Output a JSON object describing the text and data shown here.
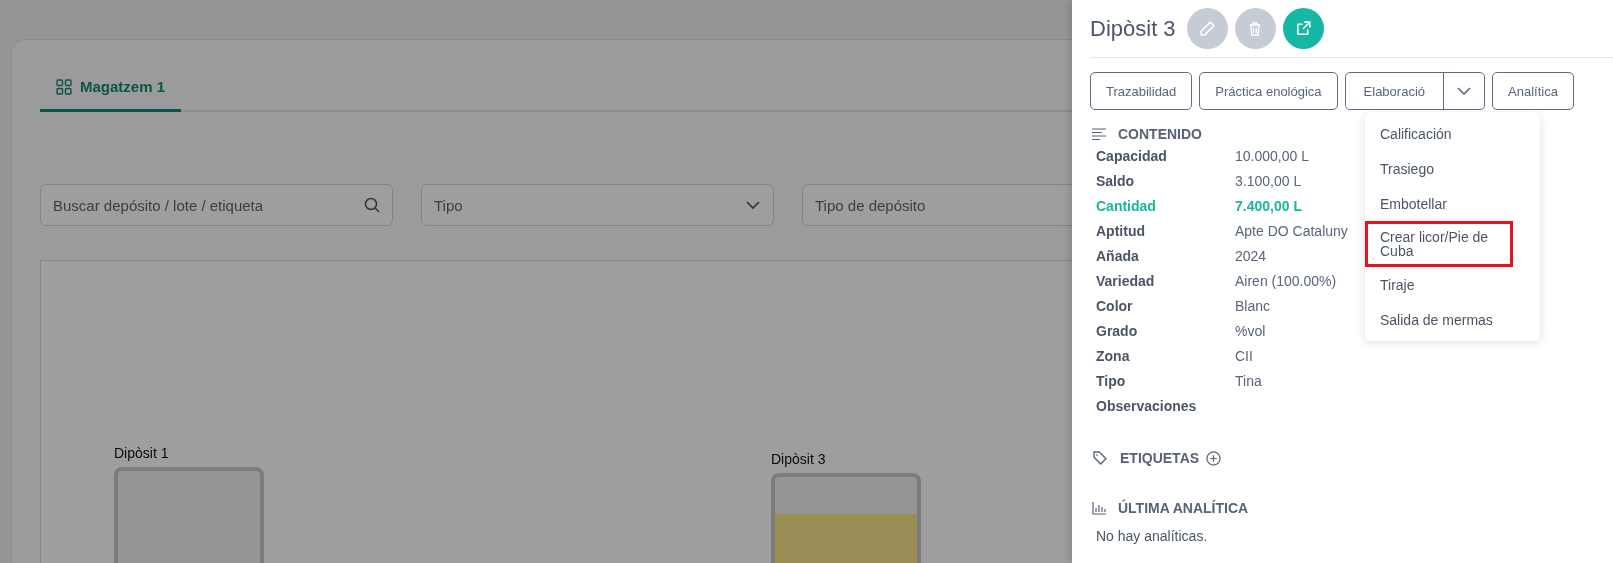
{
  "tabs": [
    {
      "label": "Magatzem 1",
      "selected": true
    }
  ],
  "filters": [
    {
      "kind": "search",
      "placeholder": "Buscar depósito / lote / etiqueta"
    },
    {
      "kind": "select",
      "placeholder": "Tipo"
    },
    {
      "kind": "select-cut",
      "placeholder": "Tipo de depósito"
    }
  ],
  "tanks": [
    {
      "name": "Dipòsit 1",
      "filled": false
    },
    {
      "name": "Dipòsit 3",
      "filled": true
    }
  ],
  "panel": {
    "title": "Dipòsit 3",
    "icon_buttons": [
      {
        "kind": "edit",
        "disabled": true
      },
      {
        "kind": "delete",
        "disabled": true
      },
      {
        "kind": "open",
        "disabled": false
      }
    ],
    "actions": [
      {
        "kind": "plain",
        "label": "Trazabilidad"
      },
      {
        "kind": "plain",
        "label": "Práctica enológica"
      },
      {
        "kind": "split",
        "label": "Elaboració"
      },
      {
        "kind": "plain",
        "label": "Analítica"
      }
    ],
    "menu": [
      {
        "label": "Calificación",
        "highlighted": false
      },
      {
        "label": "Trasiego",
        "highlighted": false
      },
      {
        "label": "Embotellar",
        "highlighted": false
      },
      {
        "label": "Crear licor/Pie de Cuba",
        "highlighted": true
      },
      {
        "label": "Tiraje",
        "highlighted": false
      },
      {
        "label": "Salida de mermas",
        "highlighted": false
      }
    ],
    "content_title": "CONTENIDO",
    "fields": [
      {
        "label": "Capacidad",
        "value": "10.000,00 L",
        "emphasis": false
      },
      {
        "label": "Saldo",
        "value": "3.100,00 L",
        "emphasis": false
      },
      {
        "label": "Cantidad",
        "value": "7.400,00 L",
        "emphasis": true
      },
      {
        "label": "Aptitud",
        "value": "Apte DO Cataluny",
        "emphasis": false
      },
      {
        "label": "Añada",
        "value": "2024",
        "emphasis": false
      },
      {
        "label": "Variedad",
        "value": "Airen (100.00%)",
        "emphasis": false
      },
      {
        "label": "Color",
        "value": "Blanc",
        "emphasis": false
      },
      {
        "label": "Grado",
        "value": "%vol",
        "emphasis": false
      },
      {
        "label": "Zona",
        "value": "CII",
        "emphasis": false
      },
      {
        "label": "Tipo",
        "value": "Tina",
        "emphasis": false
      },
      {
        "label": "Observaciones",
        "emphasis": false
      }
    ],
    "tags_title": "ETIQUETAS",
    "analytics_title": "ÚLTIMA ANALÍTICA",
    "analytics_empty": "No hay analíticas."
  }
}
